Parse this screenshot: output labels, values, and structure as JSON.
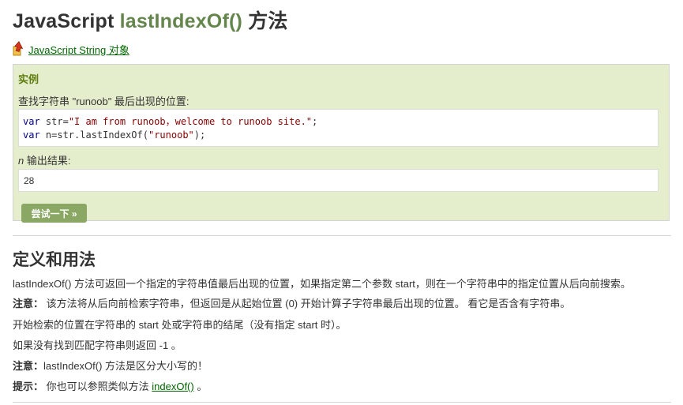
{
  "header": {
    "title_prefix": "JavaScript",
    "title_method": "lastIndexOf()",
    "title_suffix": "方法"
  },
  "back_link": {
    "label": "JavaScript String 对象",
    "icon": "up-arrow-icon"
  },
  "example": {
    "heading": "实例",
    "description": "查找字符串 \"runoob\" 最后出现的位置:",
    "code_lines": [
      {
        "kw": "var",
        "rest": " str=",
        "str": "\"I am from runoob，welcome to runoob site.\"",
        "end": ";"
      },
      {
        "kw": "var",
        "rest": " n=str.lastIndexOf(",
        "str": "\"runoob\"",
        "end": ");"
      }
    ],
    "output_var": "n",
    "output_label": " 输出结果:",
    "output_value": "28",
    "try_button": "尝试一下 »"
  },
  "definition": {
    "heading": "定义和用法",
    "line1": "lastIndexOf() 方法可返回一个指定的字符串值最后出现的位置，如果指定第二个参数 start，则在一个字符串中的指定位置从后向前搜索。",
    "note1_label": "注意：",
    "note1_text": " 该方法将从后向前检索字符串，但返回是从起始位置 (0) 开始计算子字符串最后出现的位置。 看它是否含有字符串。",
    "line3": "开始检索的位置在字符串的 start 处或字符串的结尾（没有指定 start 时）。",
    "line4": "如果没有找到匹配字符串则返回 -1 。",
    "note2_label": "注意：",
    "note2_text": "lastIndexOf() 方法是区分大小写的！",
    "tip_label": "提示：",
    "tip_text": " 你也可以参照类似方法 ",
    "tip_link": "indexOf()",
    "tip_end": " 。"
  },
  "colors": {
    "accent": "#64854c",
    "example_bg": "#e5eecc",
    "button_bg": "#8aa863",
    "link": "#006600"
  }
}
